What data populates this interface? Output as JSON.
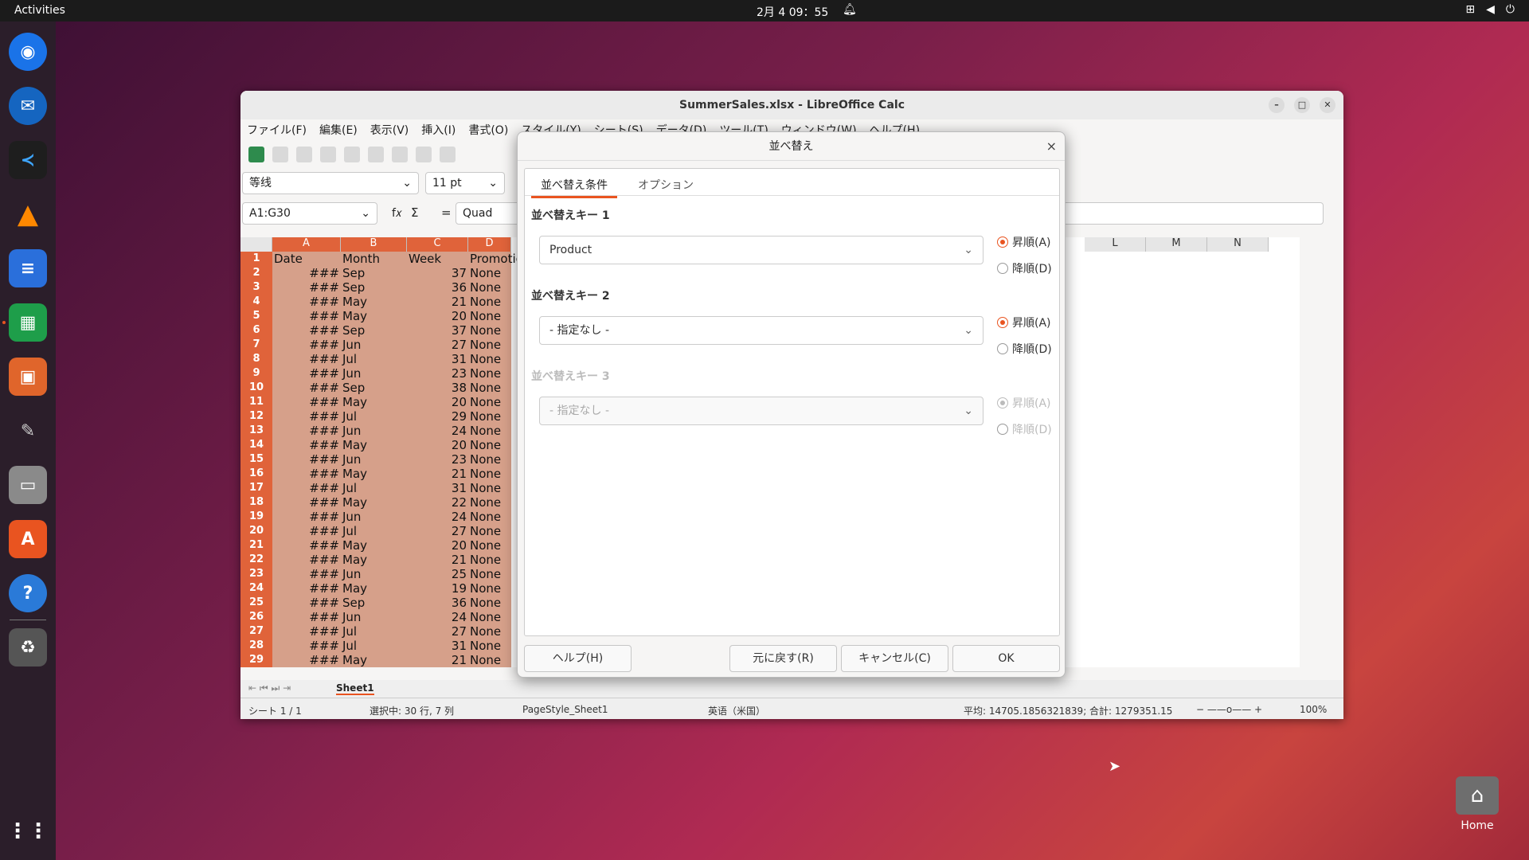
{
  "topbar": {
    "activities": "Activities",
    "clock": "2月 4  09：55"
  },
  "window": {
    "title": "SummerSales.xlsx - LibreOffice Calc"
  },
  "menu": [
    "ファイル(F)",
    "編集(E)",
    "表示(V)",
    "挿入(I)",
    "書式(O)",
    "スタイル(Y)",
    "シート(S)",
    "データ(D)",
    "ツール(T)",
    "ウィンドウ(W)",
    "ヘルプ(H)"
  ],
  "font": {
    "name": "等线",
    "size": "11 pt"
  },
  "namebox": "A1:G30",
  "formula_text": "Quad",
  "columns_left": [
    "A",
    "B",
    "C",
    "D"
  ],
  "columns_right": [
    "L",
    "M",
    "N"
  ],
  "rows": [
    {
      "n": "1",
      "a": "Date",
      "b": "Month",
      "c": "Week",
      "d": "Promotio"
    },
    {
      "n": "2",
      "a": "###",
      "b": "Sep",
      "c": "37",
      "d": "None"
    },
    {
      "n": "3",
      "a": "###",
      "b": "Sep",
      "c": "36",
      "d": "None"
    },
    {
      "n": "4",
      "a": "###",
      "b": "May",
      "c": "21",
      "d": "None"
    },
    {
      "n": "5",
      "a": "###",
      "b": "May",
      "c": "20",
      "d": "None"
    },
    {
      "n": "6",
      "a": "###",
      "b": "Sep",
      "c": "37",
      "d": "None"
    },
    {
      "n": "7",
      "a": "###",
      "b": "Jun",
      "c": "27",
      "d": "None"
    },
    {
      "n": "8",
      "a": "###",
      "b": "Jul",
      "c": "31",
      "d": "None"
    },
    {
      "n": "9",
      "a": "###",
      "b": "Jun",
      "c": "23",
      "d": "None"
    },
    {
      "n": "10",
      "a": "###",
      "b": "Sep",
      "c": "38",
      "d": "None"
    },
    {
      "n": "11",
      "a": "###",
      "b": "May",
      "c": "20",
      "d": "None"
    },
    {
      "n": "12",
      "a": "###",
      "b": "Jul",
      "c": "29",
      "d": "None"
    },
    {
      "n": "13",
      "a": "###",
      "b": "Jun",
      "c": "24",
      "d": "None"
    },
    {
      "n": "14",
      "a": "###",
      "b": "May",
      "c": "20",
      "d": "None"
    },
    {
      "n": "15",
      "a": "###",
      "b": "Jun",
      "c": "23",
      "d": "None"
    },
    {
      "n": "16",
      "a": "###",
      "b": "May",
      "c": "21",
      "d": "None"
    },
    {
      "n": "17",
      "a": "###",
      "b": "Jul",
      "c": "31",
      "d": "None"
    },
    {
      "n": "18",
      "a": "###",
      "b": "May",
      "c": "22",
      "d": "None"
    },
    {
      "n": "19",
      "a": "###",
      "b": "Jun",
      "c": "24",
      "d": "None"
    },
    {
      "n": "20",
      "a": "###",
      "b": "Jul",
      "c": "27",
      "d": "None"
    },
    {
      "n": "21",
      "a": "###",
      "b": "May",
      "c": "20",
      "d": "None"
    },
    {
      "n": "22",
      "a": "###",
      "b": "May",
      "c": "21",
      "d": "None"
    },
    {
      "n": "23",
      "a": "###",
      "b": "Jun",
      "c": "25",
      "d": "None"
    },
    {
      "n": "24",
      "a": "###",
      "b": "May",
      "c": "19",
      "d": "None"
    },
    {
      "n": "25",
      "a": "###",
      "b": "Sep",
      "c": "36",
      "d": "None"
    },
    {
      "n": "26",
      "a": "###",
      "b": "Jun",
      "c": "24",
      "d": "None"
    },
    {
      "n": "27",
      "a": "###",
      "b": "Jul",
      "c": "27",
      "d": "None"
    },
    {
      "n": "28",
      "a": "###",
      "b": "Jul",
      "c": "31",
      "d": "None"
    },
    {
      "n": "29",
      "a": "###",
      "b": "May",
      "c": "21",
      "d": "None"
    }
  ],
  "sheet_tab": "Sheet1",
  "status": {
    "sheet": "シート 1 / 1",
    "selection": "選択中: 30 行, 7 列",
    "pagestyle": "PageStyle_Sheet1",
    "lang": "英语（米国）",
    "sum": "平均: 14705.1856321839; 合計: 1279351.15",
    "zoom": "100%"
  },
  "dialog": {
    "title": "並べ替え",
    "tabs": [
      "並べ替え条件",
      "オプション"
    ],
    "key1": {
      "label": "並べ替えキー 1",
      "value": "Product"
    },
    "key2": {
      "label": "並べ替えキー 2",
      "value": "- 指定なし -"
    },
    "key3": {
      "label": "並べ替えキー 3",
      "value": "- 指定なし -"
    },
    "asc": "昇順(A)",
    "desc": "降順(D)",
    "buttons": {
      "help": "ヘルプ(H)",
      "reset": "元に戻す(R)",
      "cancel": "キャンセル(C)",
      "ok": "OK"
    }
  },
  "desktop": {
    "home": "Home"
  },
  "colors": {
    "accent": "#e95420",
    "selection": "#d6a08a"
  }
}
